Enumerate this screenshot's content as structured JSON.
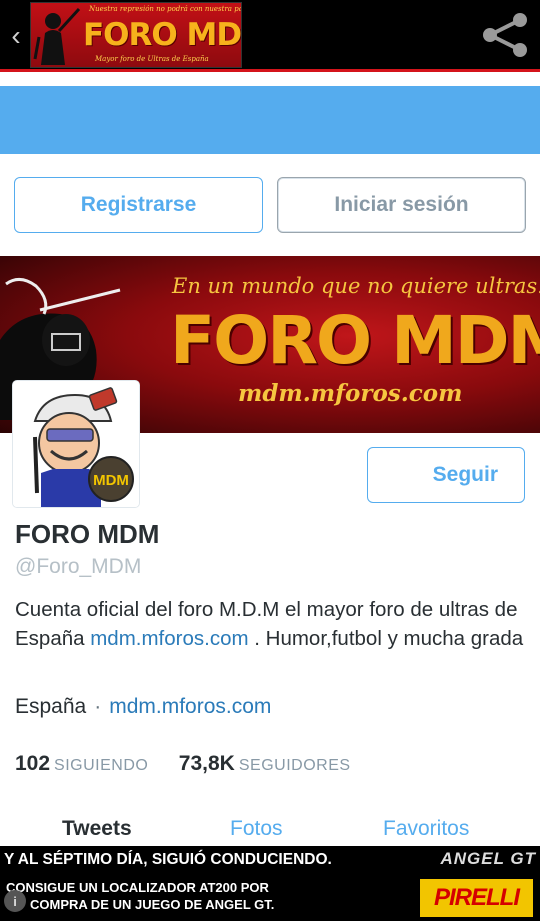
{
  "app_bar": {
    "back_icon": "chevron-left-icon",
    "share_icon": "share-icon",
    "logo": {
      "tagline": "Nuestra represión no podrá con nuestra pasión!",
      "name": "FORO MDM",
      "subtitle": "Mayor foro de Ultras de España"
    },
    "colors": {
      "background": "#000000",
      "accent": "#d4141b"
    }
  },
  "auth": {
    "register_label": "Registrarse",
    "login_label": "Iniciar sesión"
  },
  "banner": {
    "slogan": "En un mundo que no quiere ultras...",
    "name": "FORO MDM",
    "url": "mdm.mforos.com"
  },
  "avatar": {
    "badge_text": "MDM"
  },
  "profile": {
    "follow_label": "Seguir",
    "name": "FORO MDM",
    "handle": "@Foro_MDM",
    "bio_text_1": "Cuenta oficial del foro M.D.M el mayor foro de ultras de España ",
    "bio_link": "mdm.mforos.com",
    "bio_text_2": " . Humor,futbol y mucha grada",
    "location": "España",
    "separator": "·",
    "website": "mdm.mforos.com",
    "stats": [
      {
        "value": "102",
        "label": "SIGUIENDO"
      },
      {
        "value": "73,8K",
        "label": "SEGUIDORES"
      }
    ],
    "tabs": [
      "Tweets",
      "Fotos",
      "Favoritos"
    ],
    "colors": {
      "link": "#2b7bb9",
      "accent": "#55acee",
      "text": "#292f33"
    }
  },
  "ad": {
    "headline": "Y AL SÉPTIMO DÍA, SIGUIÓ CONDUCIENDO.",
    "line_1": "CONSIGUE UN LOCALIZADOR AT200 POR",
    "line_2": "COMPRA DE UN JUEGO DE ANGEL GT.",
    "brand": "ANGEL GT",
    "sponsor": "PIRELLI"
  }
}
